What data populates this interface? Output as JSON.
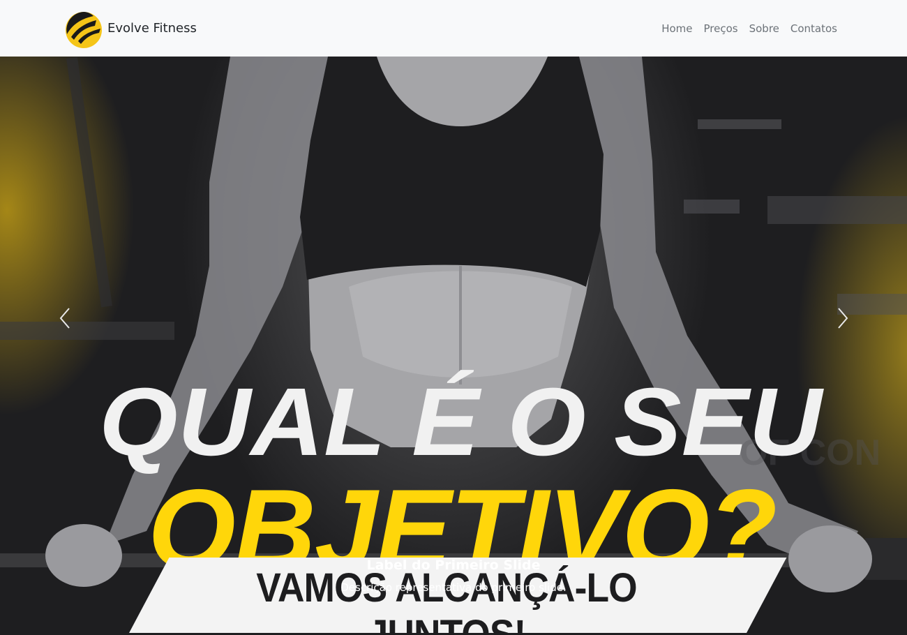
{
  "navbar": {
    "brand_name": "Evolve Fitness",
    "links": [
      "Home",
      "Preços",
      "Sobre",
      "Contatos"
    ]
  },
  "hero": {
    "headline_line1": "QUAL É O SEU",
    "headline_line2": "OBJETIVO?",
    "banner_text": "VAMOS ALCANÇÁ-LO JUNTOS!"
  },
  "carousel": {
    "caption_title": "Label do Primeiro Slide",
    "caption_text": "Descrição representativa do primeiro slide."
  },
  "colors": {
    "accent_yellow": "#ffd60a",
    "navbar_bg": "#f8f9fa",
    "nav_link": "#6c7278"
  },
  "icons": {
    "brand": "evolve-logo-icon",
    "prev": "chevron-left-icon",
    "next": "chevron-right-icon"
  }
}
